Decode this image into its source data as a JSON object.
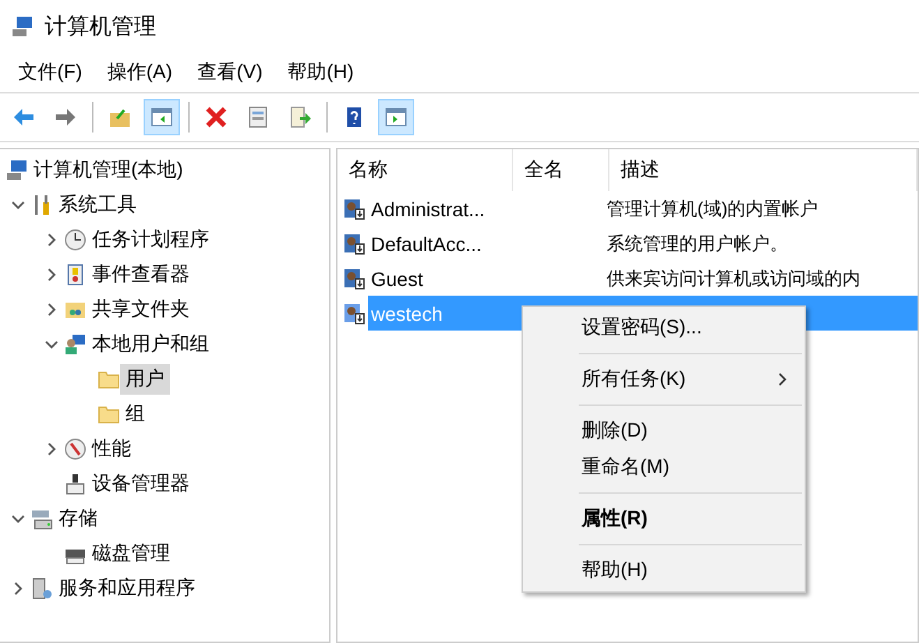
{
  "window": {
    "title": "计算机管理"
  },
  "menu_bar": [
    "文件(F)",
    "操作(A)",
    "查看(V)",
    "帮助(H)"
  ],
  "toolbar": [
    {
      "kind": "button",
      "pressed": false
    },
    {
      "kind": "button",
      "pressed": false
    },
    {
      "kind": "separator"
    },
    {
      "kind": "button",
      "pressed": false
    },
    {
      "kind": "button",
      "pressed": true
    },
    {
      "kind": "separator"
    },
    {
      "kind": "button",
      "pressed": false
    },
    {
      "kind": "button",
      "pressed": false
    },
    {
      "kind": "button",
      "pressed": false
    },
    {
      "kind": "separator"
    },
    {
      "kind": "button",
      "pressed": false
    },
    {
      "kind": "button",
      "pressed": true
    }
  ],
  "tree": [
    {
      "label": "计算机管理(本地)",
      "selected": false,
      "children": [
        {
          "label": "系统工具",
          "expanded": true,
          "selected": false,
          "children": [
            {
              "label": "任务计划程序",
              "expanded": false,
              "selected": false
            },
            {
              "label": "事件查看器",
              "expanded": false,
              "selected": false
            },
            {
              "label": "共享文件夹",
              "expanded": false,
              "selected": false
            },
            {
              "label": "本地用户和组",
              "expanded": true,
              "selected": false,
              "children": [
                {
                  "label": "用户",
                  "selected": true
                },
                {
                  "label": "组",
                  "selected": false
                }
              ]
            },
            {
              "label": "性能",
              "expanded": false,
              "selected": false
            },
            {
              "label": "设备管理器",
              "selected": false
            }
          ]
        },
        {
          "label": "存储",
          "expanded": true,
          "selected": false,
          "children": [
            {
              "label": "磁盘管理",
              "selected": false
            }
          ]
        },
        {
          "label": "服务和应用程序",
          "expanded": false,
          "selected": false
        }
      ]
    }
  ],
  "table": {
    "columns": [
      "名称",
      "全名",
      "描述"
    ],
    "rows": [
      {
        "name": "Administrat...",
        "description": "管理计算机(域)的内置帐户",
        "selected": false
      },
      {
        "name": "DefaultAcc...",
        "description": "系统管理的用户帐户。",
        "selected": false
      },
      {
        "name": "Guest",
        "description": "供来宾访问计算机或访问域的内",
        "selected": false
      },
      {
        "name": "westech",
        "selected": true
      }
    ]
  },
  "context_menu": [
    {
      "kind": "item",
      "label": "设置密码(S)...",
      "submenu": false,
      "default": false
    },
    {
      "kind": "separator"
    },
    {
      "kind": "item",
      "label": "所有任务(K)",
      "submenu": true,
      "default": false
    },
    {
      "kind": "separator"
    },
    {
      "kind": "item",
      "label": "删除(D)",
      "submenu": false,
      "default": false
    },
    {
      "kind": "item",
      "label": "重命名(M)",
      "submenu": false,
      "default": false
    },
    {
      "kind": "separator"
    },
    {
      "kind": "item",
      "label": "属性(R)",
      "submenu": false,
      "default": true
    },
    {
      "kind": "separator"
    },
    {
      "kind": "item",
      "label": "帮助(H)",
      "submenu": false,
      "default": false
    }
  ]
}
